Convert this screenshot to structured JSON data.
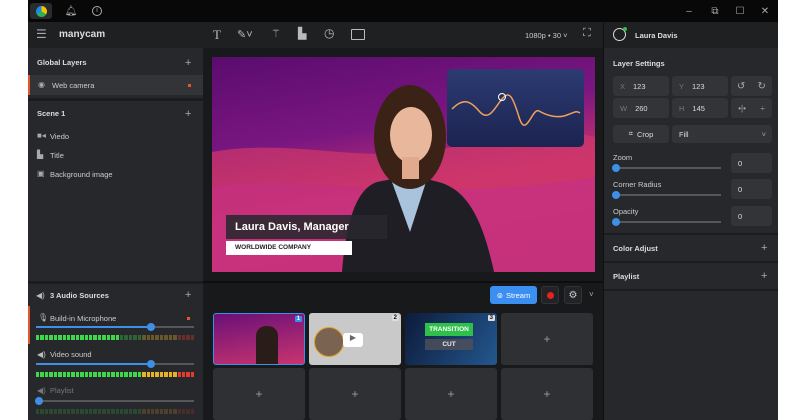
{
  "window": {
    "app_name": "manycam"
  },
  "left": {
    "global_layers": {
      "title": "Global Layers",
      "items": [
        {
          "label": "Web camera"
        }
      ]
    },
    "scene": {
      "title": "Scene 1",
      "items": [
        {
          "label": "Viedo",
          "icon": "video-icon"
        },
        {
          "label": "Title",
          "icon": "title-icon"
        },
        {
          "label": "Background image",
          "icon": "image-icon"
        }
      ]
    },
    "audio": {
      "title": "3 Audio Sources",
      "sources": [
        {
          "label": "Build-in Microphone",
          "level": 0.73
        },
        {
          "label": "Video sound",
          "level": 0.73
        },
        {
          "label": "Playlist",
          "level": 0.0
        }
      ]
    }
  },
  "toolbar": {
    "resolution": "1080p • 30"
  },
  "preview": {
    "lower_third_name": "Laura Davis, Manager",
    "lower_third_company": "WORLDWIDE COMPANY"
  },
  "stream_bar": {
    "stream_label": "Stream"
  },
  "scenes": {
    "thumbs": [
      {
        "number": "1"
      },
      {
        "number": "2"
      },
      {
        "number": "3",
        "transition_label": "TRANSITION",
        "cut_label": "CUT"
      }
    ],
    "add_label": "+"
  },
  "right": {
    "user": "Laura Davis",
    "layer_settings": {
      "title": "Layer Settings",
      "x_label": "X",
      "x": "123",
      "y_label": "Y",
      "y": "123",
      "w_label": "W",
      "w": "260",
      "h_label": "H",
      "h": "145",
      "crop_label": "Crop",
      "fill_option": "Fill",
      "zoom_label": "Zoom",
      "zoom": "0",
      "corner_label": "Corner Radius",
      "corner": "0",
      "opacity_label": "Opacity",
      "opacity": "0"
    },
    "color_adjust": "Color Adjust",
    "playlist": "Playlist"
  }
}
